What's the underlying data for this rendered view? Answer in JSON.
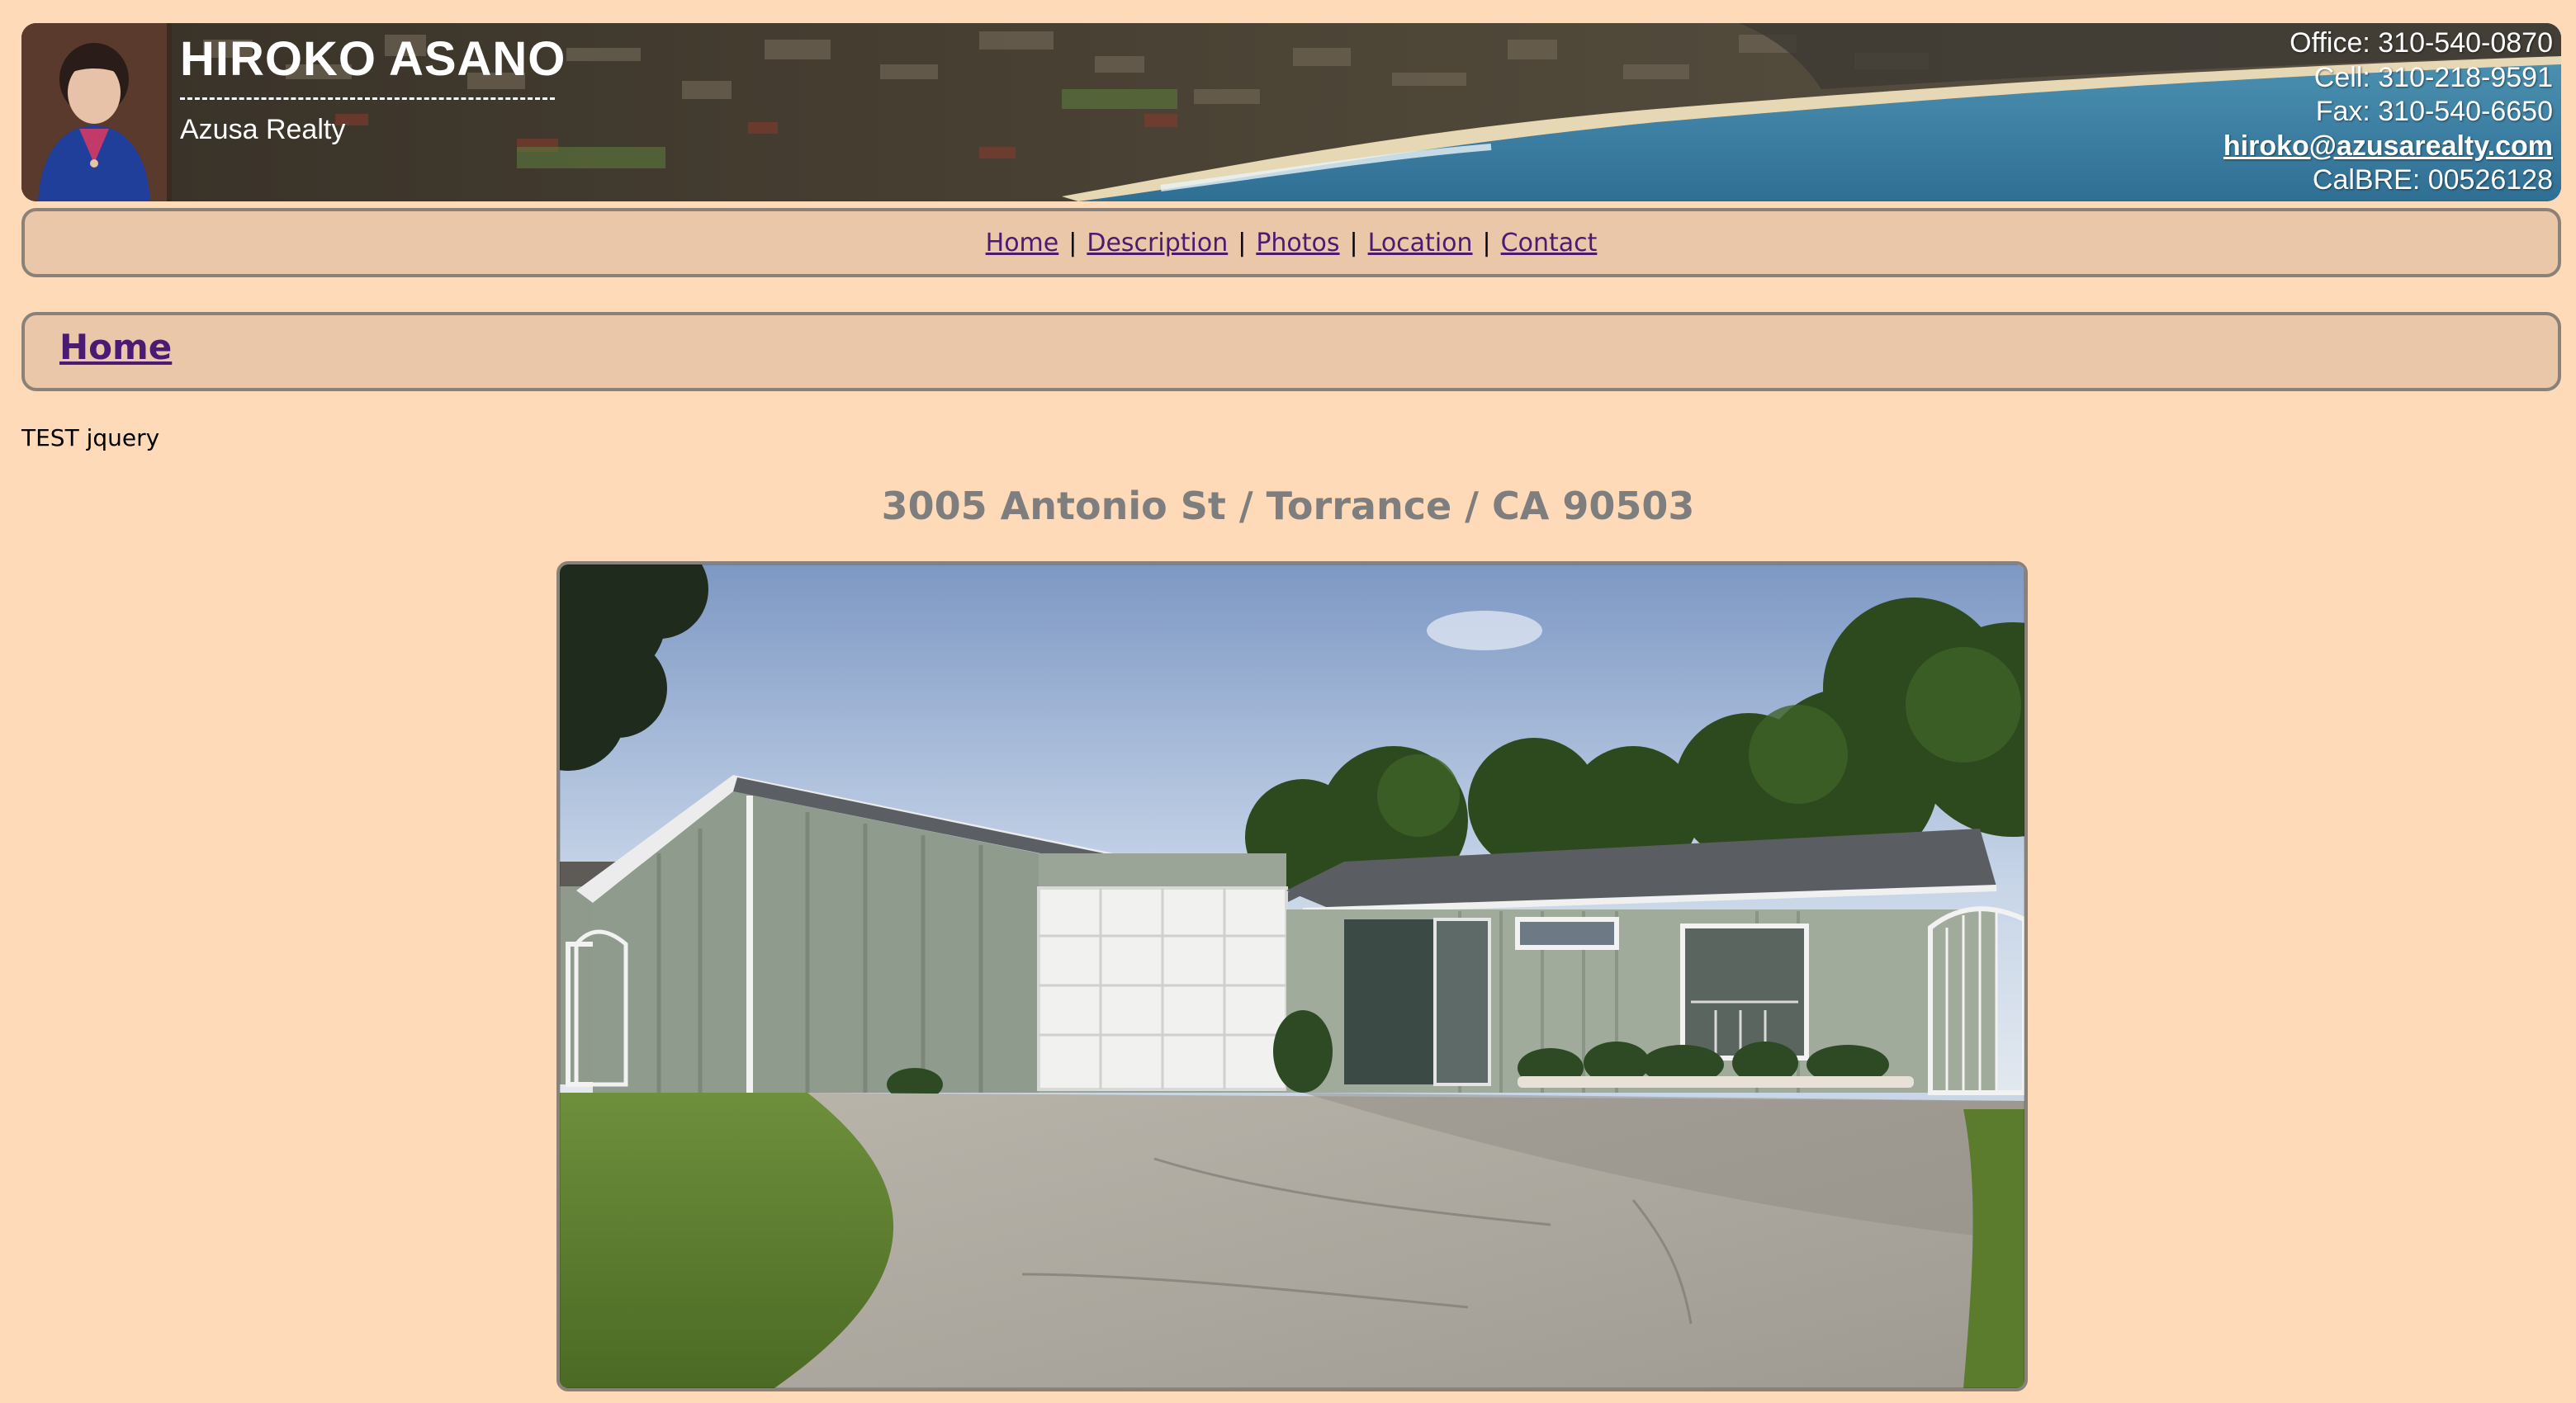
{
  "header": {
    "name": "HIROKO ASANO",
    "company": "Azusa Realty",
    "office": "Office: 310-540-0870",
    "cell": "Cell: 310-218-9591",
    "fax": "Fax: 310-540-6650",
    "email": "hiroko@azusarealty.com",
    "license": "CalBRE: 00526128"
  },
  "nav": {
    "items": [
      {
        "label": "Home"
      },
      {
        "label": "Description"
      },
      {
        "label": "Photos"
      },
      {
        "label": "Location"
      },
      {
        "label": "Contact"
      }
    ],
    "separator": "|"
  },
  "section": {
    "title": "Home"
  },
  "content": {
    "test_text": "TEST jquery",
    "address": "3005 Antonio St / Torrance / CA 90503"
  },
  "colors": {
    "page_background": "#ffdab9",
    "bar_background": "#eac7a9",
    "link": "#4b1a73",
    "address_text": "#7e7e7e"
  }
}
